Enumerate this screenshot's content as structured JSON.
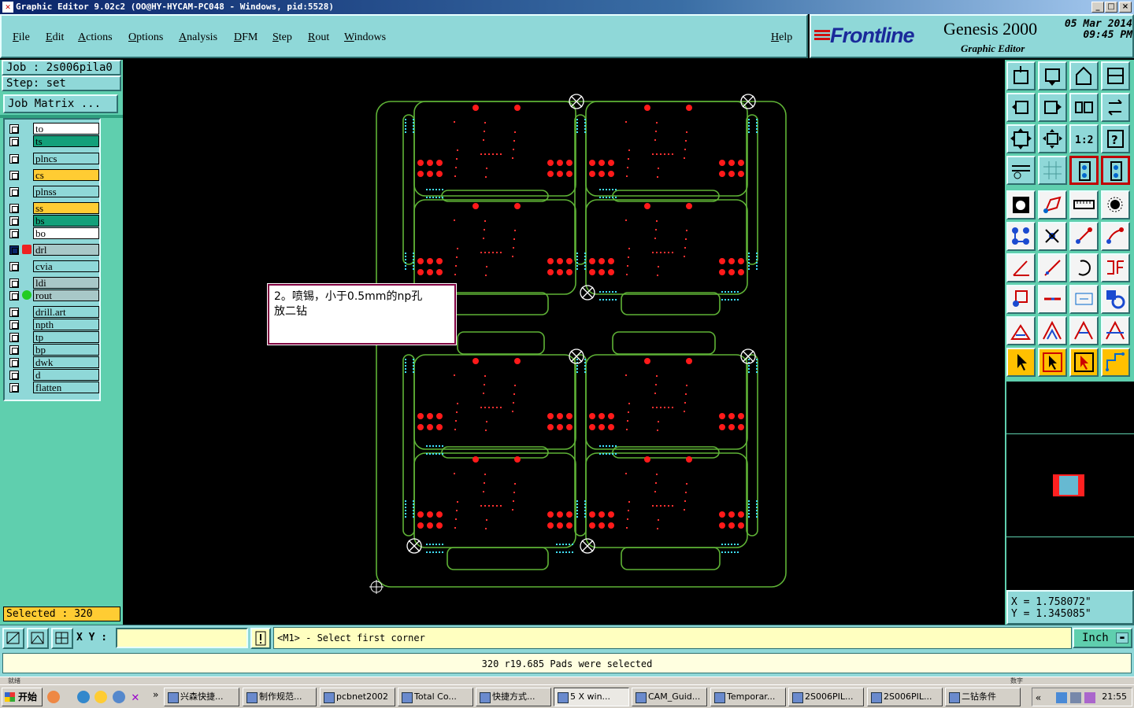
{
  "window": {
    "title": "Graphic Editor 9.02c2  (OO@HY-HYCAM-PC048 - Windows, pid:5528)"
  },
  "menu": [
    "File",
    "Edit",
    "Actions",
    "Options",
    "Analysis",
    "DFM",
    "Step",
    "Rout",
    "Windows"
  ],
  "help": "Help",
  "brand": {
    "name": "Frontline",
    "product": "Genesis 2000",
    "subtitle": "Graphic Editor",
    "date": "05 Mar 2014",
    "time": "09:45 PM"
  },
  "job": {
    "job_label": "Job : 2s006pila0",
    "step_label": "Step: set",
    "matrix_button": "Job Matrix ..."
  },
  "layers": [
    {
      "name": "to",
      "color": "#ffffff"
    },
    {
      "name": "ts",
      "color": "#13a07a"
    },
    {
      "name": "plncs",
      "color": "#8fd8d8"
    },
    {
      "name": "cs",
      "color": "#ffcc33"
    },
    {
      "name": "plnss",
      "color": "#8fd8d8"
    },
    {
      "name": "ss",
      "color": "#ffcc33"
    },
    {
      "name": "bs",
      "color": "#13a07a"
    },
    {
      "name": "bo",
      "color": "#ffffff"
    },
    {
      "name": "drl",
      "color": "#a8c8c8"
    },
    {
      "name": "cvia",
      "color": "#8fd8d8"
    },
    {
      "name": "ldi",
      "color": "#a8c8c8"
    },
    {
      "name": "rout",
      "color": "#a8c8c8"
    },
    {
      "name": "drill.art",
      "color": "#8fd8d8"
    },
    {
      "name": "npth",
      "color": "#8fd8d8"
    },
    {
      "name": "tp",
      "color": "#8fd8d8"
    },
    {
      "name": "bp",
      "color": "#8fd8d8"
    },
    {
      "name": "dwk",
      "color": "#8fd8d8"
    },
    {
      "name": "d",
      "color": "#8fd8d8"
    },
    {
      "name": "flatten",
      "color": "#8fd8d8"
    }
  ],
  "selected": "Selected : 320",
  "annotation": {
    "line1": "2。喷锡，小于0.5mm的np孔",
    "line2": "放二钻"
  },
  "coords": {
    "x": "X  =  1.758072\"",
    "y": "Y  =  1.345085\""
  },
  "command": {
    "xy_label": "X Y :",
    "xy_value": "",
    "prompt": "<M1> - Select first corner",
    "units": "Inch"
  },
  "status": "320 r19.685 Pads were selected",
  "taskstrip": {
    "left": "就绪",
    "right": "数字"
  },
  "taskbar": {
    "start": "开始",
    "items": [
      "兴森快捷...",
      "制作规范...",
      "pcbnet2002",
      "Total Co...",
      "快捷方式...",
      "5 X win...",
      "CAM_Guid...",
      "Temporar...",
      "2S006PIL...",
      "2S006PIL...",
      "二钻条件"
    ],
    "clock": "21:55"
  },
  "colors": {
    "panel": "#8fd8d8",
    "panel_dark": "#5fcfae",
    "outline": "#6fcf3f",
    "pad": "#ff1a1a",
    "via": "#40e0ff",
    "highlight": "#ffcc33"
  }
}
